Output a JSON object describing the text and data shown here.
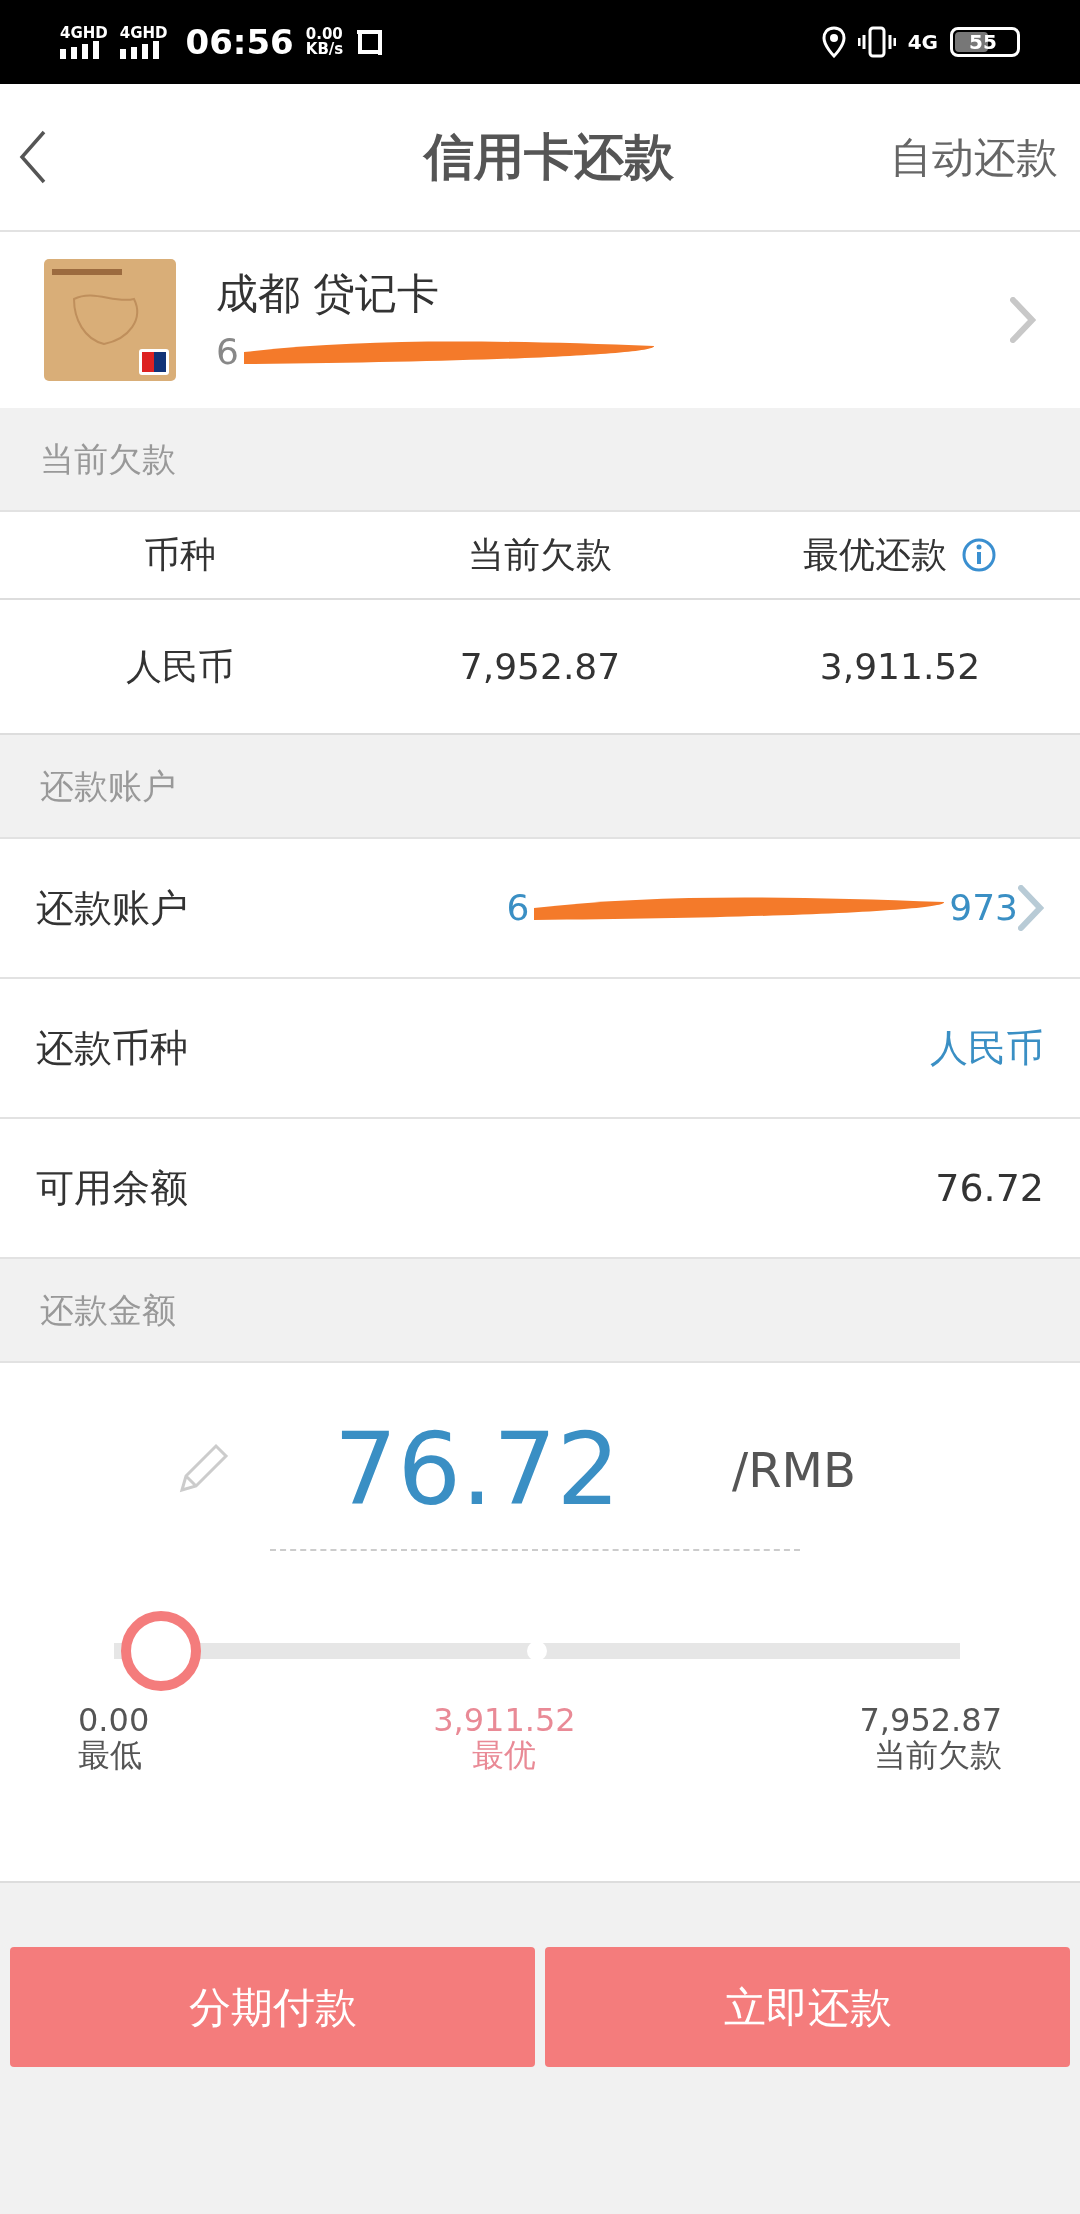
{
  "status_bar": {
    "signal_1": "4GHD",
    "signal_2": "4GHD",
    "time": "06:56",
    "speed_value": "0.00",
    "speed_unit": "KB/s",
    "network": "4G",
    "battery": "55"
  },
  "header": {
    "title": "信用卡还款",
    "action": "自动还款"
  },
  "card": {
    "name": "成都 贷记卡",
    "number_start": "6"
  },
  "debt_section": {
    "title": "当前欠款",
    "columns": [
      "币种",
      "当前欠款",
      "最优还款"
    ],
    "row": [
      "人民币",
      "7,952.87",
      "3,911.52"
    ]
  },
  "account_section": {
    "title": "还款账户",
    "rows": [
      {
        "kind": "account",
        "label": "还款账户",
        "value_start": "6",
        "value_end": "973"
      },
      {
        "kind": "link",
        "label": "还款币种",
        "value": "人民币"
      },
      {
        "kind": "plain",
        "label": "可用余额",
        "value": "76.72"
      }
    ]
  },
  "amount_section": {
    "title": "还款金额",
    "amount": "76.72",
    "unit": "/RMB",
    "slider": {
      "level": 0.0096,
      "marks": [
        {
          "value": "0.00",
          "label": "最低",
          "highlight": false
        },
        {
          "value": "3,911.52",
          "label": "最优",
          "highlight": true
        },
        {
          "value": "7,952.87",
          "label": "当前欠款",
          "highlight": false
        }
      ]
    }
  },
  "buttons": [
    "分期付款",
    "立即还款"
  ]
}
